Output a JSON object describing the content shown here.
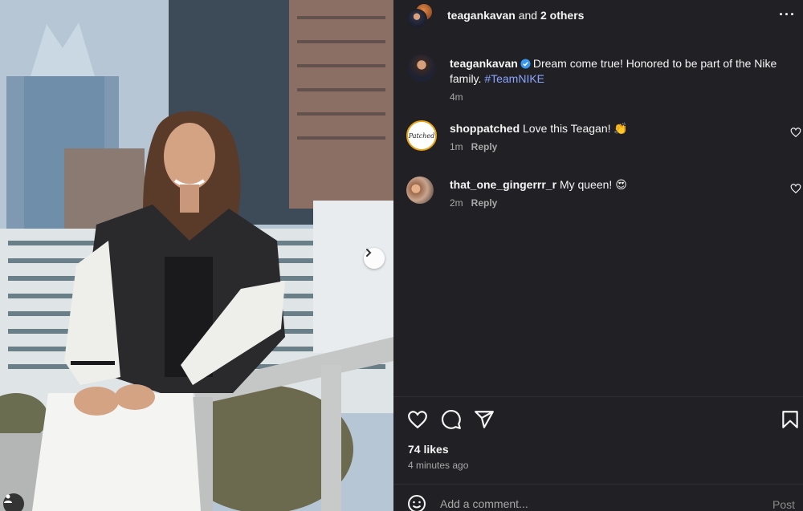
{
  "header": {
    "username": "teagankavan",
    "and_text": " and ",
    "others": "2 others",
    "more_glyph": "···"
  },
  "caption": {
    "username": "teagankavan",
    "verified_icon": "verified-badge-icon",
    "text_before": "Dream come true! Honored to be part of the Nike family. ",
    "hashtag": "#TeamNIKE",
    "time": "4m"
  },
  "comments": [
    {
      "username": "shoppatched",
      "text": "Love this Teagan! 👏",
      "time": "1m",
      "reply": "Reply",
      "avatar_text": "Patched"
    },
    {
      "username": "that_one_gingerrr_r",
      "text": "My queen! 😍",
      "time": "2m",
      "reply": "Reply"
    }
  ],
  "actions": {
    "icons": [
      "heart-icon",
      "comment-icon",
      "share-icon",
      "bookmark-icon"
    ],
    "likes": "74 likes",
    "posted": "4 minutes ago"
  },
  "composer": {
    "placeholder": "Add a comment...",
    "post_label": "Post"
  },
  "colors": {
    "panel_bg": "#212125",
    "link": "#8aa4ff",
    "verified": "#3897f0",
    "muted": "#a8a8a8"
  }
}
